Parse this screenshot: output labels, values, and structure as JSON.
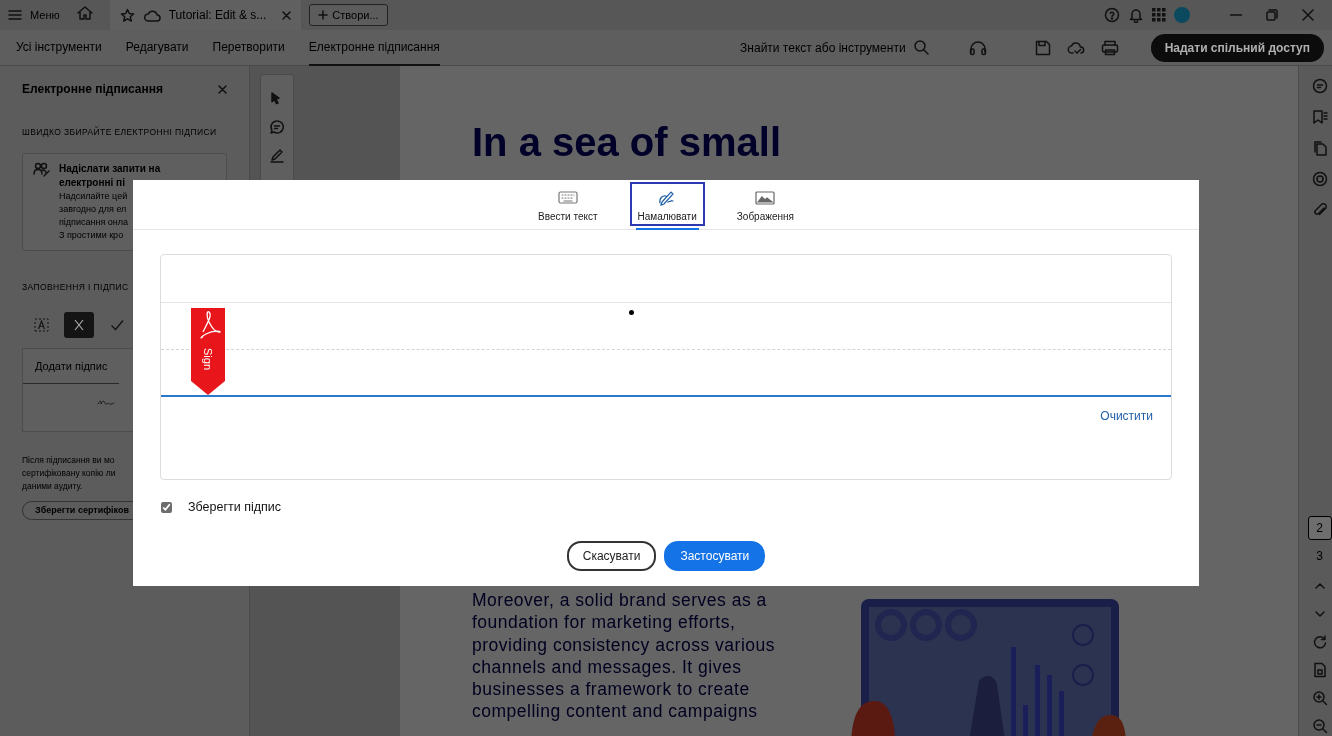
{
  "title_bar": {
    "menu_label": "Меню",
    "document_tab": {
      "title": "Tutorial: Edit & s..."
    },
    "create_button": "Створи..."
  },
  "tool_tabs": [
    {
      "label": "Усі інструменти",
      "selected": false
    },
    {
      "label": "Редагувати",
      "selected": false
    },
    {
      "label": "Перетворити",
      "selected": false
    },
    {
      "label": "Електронне підписання",
      "selected": true
    }
  ],
  "search": {
    "label": "Знайти текст або інструменти"
  },
  "share_button": "Надати спільний доступ",
  "left_panel": {
    "title": "Електронне підписання",
    "section_1": "ШВИДКО ЗБИРАЙТЕ ЕЛЕКТРОННІ ПІДПИСИ",
    "request_card": {
      "title_lines": [
        "Надіслати запити на",
        "електронні пі"
      ],
      "description_lines": [
        "Надсилайте цей",
        "завгодно для ел",
        "підписання онла",
        "З простими кро"
      ]
    },
    "section_2": "ЗАПОВНЕННЯ І ПІДПИС",
    "fill_tools": [
      {
        "kind": "text-field",
        "selected": false
      },
      {
        "kind": "cross",
        "selected": true
      },
      {
        "kind": "check",
        "selected": false
      }
    ],
    "add_signature": "Додати підпис",
    "note_lines": [
      "Після підписання ви мо",
      "сертифіковану копію ли",
      "даними аудиту."
    ],
    "save_certified_button": "Зберегти сертифіков"
  },
  "document": {
    "heading": "In a sea of small",
    "paragraph_lines": [
      "Moreover, a solid brand serves as a",
      "foundation for marketing efforts,",
      "providing consistency across various",
      "channels and messages. It gives",
      "businesses a framework to create",
      "compelling content and campaigns"
    ]
  },
  "page_nav": {
    "pages": [
      {
        "label": "2",
        "selected": true
      },
      {
        "label": "3",
        "selected": false
      }
    ]
  },
  "signature_dialog": {
    "tabs": [
      {
        "kind": "type",
        "label": "Ввести текст",
        "selected": false
      },
      {
        "kind": "draw",
        "label": "Намалювати",
        "selected": true
      },
      {
        "kind": "image",
        "label": "Зображення",
        "selected": false
      }
    ],
    "sign_tag": "Sign",
    "clear_link": "Очистити",
    "save_signature": {
      "label": "Зберегти підпис",
      "checked": true
    },
    "buttons": [
      {
        "kind": "secondary",
        "label": "Скасувати"
      },
      {
        "kind": "primary",
        "label": "Застосувати"
      }
    ]
  }
}
